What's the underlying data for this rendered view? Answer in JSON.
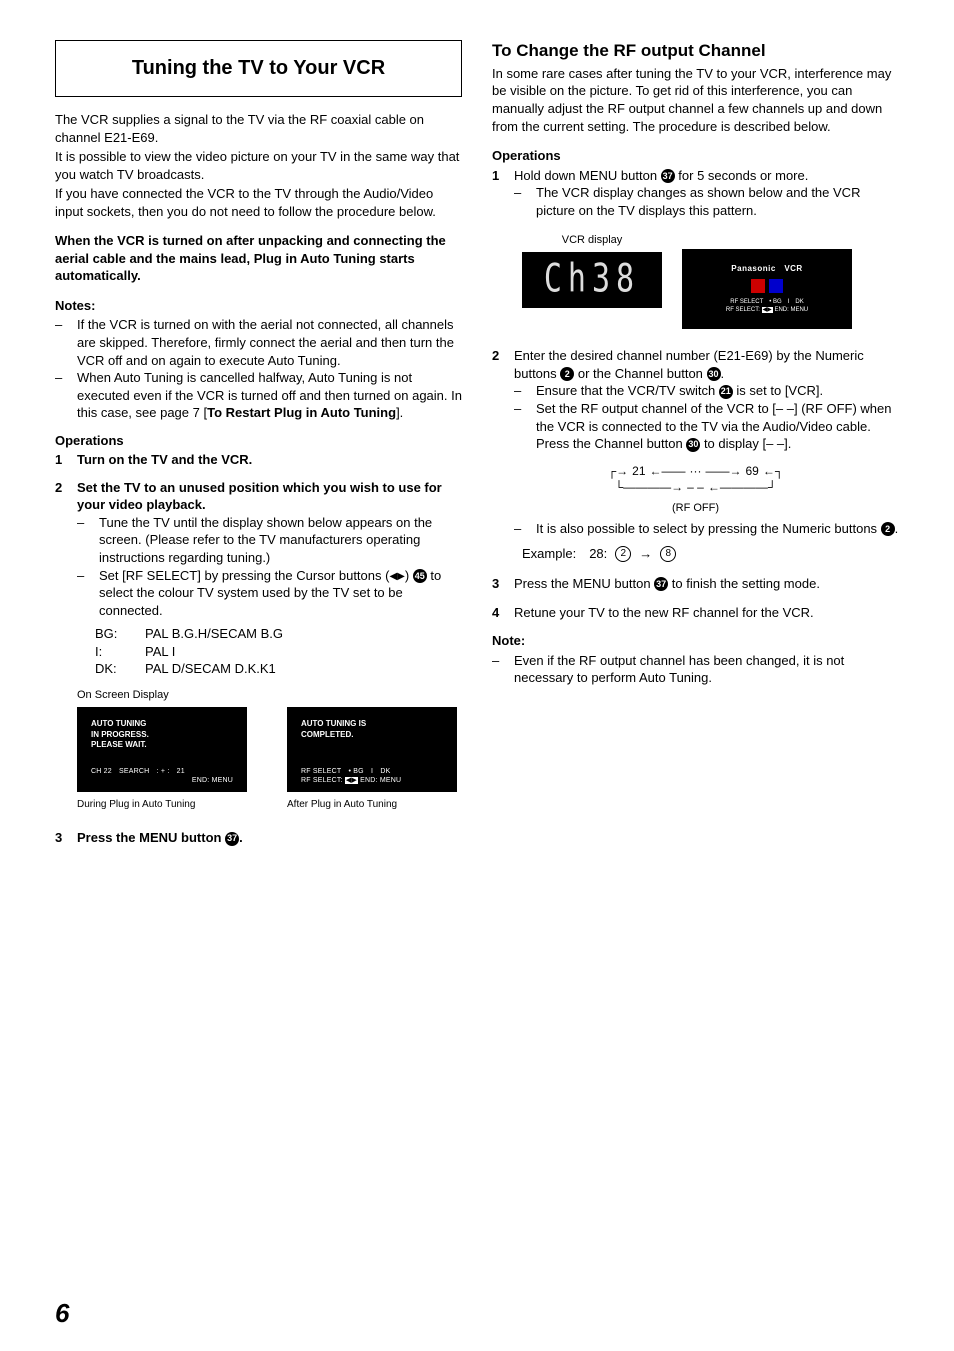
{
  "left": {
    "title": "Tuning the TV to Your VCR",
    "intro1": "The VCR supplies a signal to the TV via the RF coaxial cable on channel E21-E69.",
    "intro2": "It is possible to view the video picture on your TV in the same way that you watch TV broadcasts.",
    "intro3": "If you have connected the VCR to the TV through the Audio/Video input sockets, then you do not need to follow the procedure below.",
    "callout": "When the VCR is turned on after unpacking and connecting the aerial cable and the mains lead, Plug in Auto Tuning starts automatically.",
    "notes_h": "Notes:",
    "note1": "If the VCR is turned on with the aerial not connected, all channels are skipped. Therefore, firmly connect the aerial and then turn the VCR off and on again to execute Auto Tuning.",
    "note2a": "When Auto Tuning is cancelled halfway, Auto Tuning is not executed even if the VCR is turned off and then turned on again. In this case, see page 7 [",
    "note2b": "To Restart Plug in Auto Tuning",
    "note2c": "].",
    "ops_h": "Operations",
    "op1": "Turn on the TV and the VCR.",
    "op2": "Set the TV to an unused position which you wish to use for your video playback.",
    "op2a": "Tune the TV until the display shown below appears on the screen. (Please refer to the TV manufacturers operating instructions regarding tuning.)",
    "op2b_pre": "Set [RF SELECT] by pressing the Cursor buttons (",
    "op2b_post": " to select the colour TV system used by the TV set to be connected.",
    "sys": {
      "bg_k": "BG:",
      "bg_v": "PAL B.G.H/SECAM B.G",
      "i_k": "I:",
      "i_v": "PAL I",
      "dk_k": "DK:",
      "dk_v": "PAL D/SECAM D.K.K1"
    },
    "osd_label": "On Screen Display",
    "osd1_l1": "AUTO TUNING",
    "osd1_l2": "IN PROGRESS.",
    "osd1_l3": "PLEASE WAIT.",
    "osd1_foot": "CH 22 SEARCH : + : 21",
    "osd1_foot2": "END: MENU",
    "osd1_cap": "During Plug in Auto Tuning",
    "osd2_l1": "AUTO TUNING IS",
    "osd2_l2": "COMPLETED.",
    "osd2_foot1": "RF SELECT • BG I DK",
    "osd2_foot2_a": "RF SELECT:",
    "osd2_foot2_b": "END: MENU",
    "osd2_cap": "After Plug in Auto Tuning",
    "op3_pre": "Press the MENU button ",
    "op3_post": "."
  },
  "right": {
    "title": "To Change the RF output Channel",
    "intro": "In some rare cases after tuning the TV to your VCR, interference may be visible on the picture. To get rid of this interference, you can manually adjust the RF output channel a few channels up and down from the current setting. The procedure is described below.",
    "ops_h": "Operations",
    "op1_pre": "Hold down MENU button ",
    "op1_post": " for 5 seconds or more.",
    "op1a": "The VCR display changes as shown below and the VCR picture on the TV displays this pattern.",
    "vcr_label": "VCR display",
    "vcr_text": "Ch38",
    "tv_title": "Panasonic VCR",
    "tv_foot1": "RF SELECT • BG I DK",
    "tv_foot2_a": "RF SELECT:",
    "tv_foot2_b": "END: MENU",
    "op2_pre": "Enter the desired channel number (E21-E69) by the Numeric buttons ",
    "op2_mid": " or the Channel button ",
    "op2_post": ".",
    "op2a_pre": "Ensure that the VCR/TV switch ",
    "op2a_post": " is set to [VCR].",
    "op2b": "Set the RF output channel of the VCR to [– –] (RF OFF) when the VCR is connected to the TV via the Audio/Video cable.",
    "op2b2_pre": "Press the Channel button ",
    "op2b2_post": " to display [– –].",
    "diag_l": "21",
    "diag_r": "69",
    "diag_dots": "···",
    "diag_dash": "– –",
    "rfoff": "(RF OFF)",
    "op2c_pre": "It is also possible to select by pressing the Numeric buttons ",
    "op2c_post": ".",
    "example_label": "Example: 28:",
    "ex_a": "2",
    "ex_arrow": "→",
    "ex_b": "8",
    "op3_pre": "Press the MENU button ",
    "op3_post": " to finish the setting mode.",
    "op4": "Retune your TV to the new RF channel for the VCR.",
    "note_h": "Note:",
    "note1": "Even if the RF output channel has been changed, it is not necessary to perform Auto Tuning."
  },
  "refs": {
    "r2": "2",
    "r21": "21",
    "r30": "30",
    "r37": "37",
    "r45": "45"
  },
  "page": "6"
}
